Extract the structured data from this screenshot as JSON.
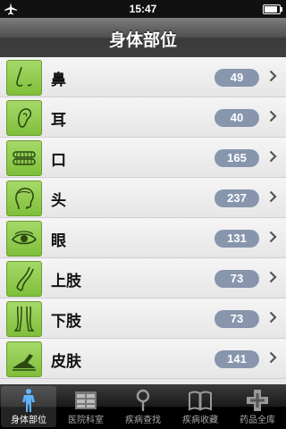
{
  "status": {
    "time": "15:47",
    "battery_level": 0.9
  },
  "nav": {
    "title": "身体部位"
  },
  "items": [
    {
      "label": "鼻",
      "count": "49",
      "icon": "nose-icon"
    },
    {
      "label": "耳",
      "count": "40",
      "icon": "ear-icon"
    },
    {
      "label": "口",
      "count": "165",
      "icon": "mouth-icon"
    },
    {
      "label": "头",
      "count": "237",
      "icon": "head-icon"
    },
    {
      "label": "眼",
      "count": "131",
      "icon": "eye-icon"
    },
    {
      "label": "上肢",
      "count": "73",
      "icon": "arm-icon"
    },
    {
      "label": "下肢",
      "count": "73",
      "icon": "legs-icon"
    },
    {
      "label": "皮肤",
      "count": "141",
      "icon": "skin-icon"
    }
  ],
  "tabs": [
    {
      "label": "身体部位",
      "icon": "body-icon",
      "selected": true
    },
    {
      "label": "医院科室",
      "icon": "hospital-departments-icon",
      "selected": false
    },
    {
      "label": "疾病查找",
      "icon": "magnifier-icon",
      "selected": false
    },
    {
      "label": "疾病收藏",
      "icon": "book-icon",
      "selected": false
    },
    {
      "label": "药品全库",
      "icon": "medicine-cross-icon",
      "selected": false
    }
  ],
  "colors": {
    "thumb_green": "#8fca4e",
    "badge": "#8796ad",
    "nav_dark": "#3f3f3f"
  }
}
